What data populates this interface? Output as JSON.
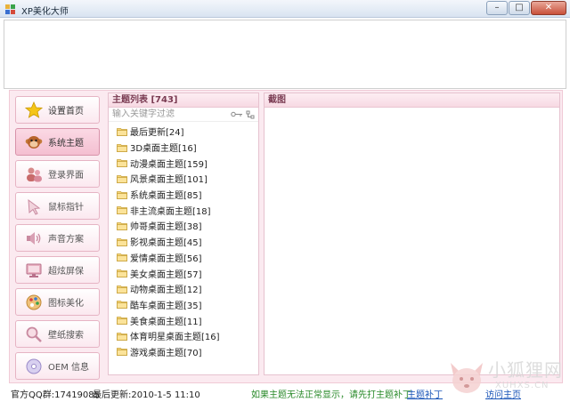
{
  "window": {
    "title": "XP美化大师",
    "minimize_glyph": "–",
    "maximize_glyph": "□",
    "close_glyph": "✕"
  },
  "sidebar": {
    "items": [
      {
        "label": "设置首页",
        "icon": "star-icon"
      },
      {
        "label": "系统主题",
        "icon": "monkey-icon",
        "active": true
      },
      {
        "label": "登录界面",
        "icon": "users-icon"
      },
      {
        "label": "鼠标指针",
        "icon": "cursor-icon"
      },
      {
        "label": "声音方案",
        "icon": "speaker-icon"
      },
      {
        "label": "超炫屏保",
        "icon": "monitor-icon"
      },
      {
        "label": "图标美化",
        "icon": "palette-icon"
      },
      {
        "label": "壁纸搜索",
        "icon": "magnifier-icon"
      },
      {
        "label": "OEM 信息",
        "icon": "cd-icon"
      }
    ]
  },
  "theme_list": {
    "header": "主题列表 [743]",
    "filter_placeholder": "输入关键字过滤",
    "items": [
      "最后更新[24]",
      "3D桌面主题[16]",
      "动漫桌面主题[159]",
      "风景桌面主题[101]",
      "系统桌面主题[85]",
      "非主流桌面主题[18]",
      "帅哥桌面主题[38]",
      "影视桌面主题[45]",
      "爱情桌面主题[56]",
      "美女桌面主题[57]",
      "动物桌面主题[12]",
      "酷车桌面主题[35]",
      "美食桌面主题[11]",
      "体育明星桌面主题[16]",
      "游戏桌面主题[70]"
    ]
  },
  "preview": {
    "header": "截图"
  },
  "status": {
    "qq": "官方QQ群:17419085",
    "updated": "最后更新:2010-1-5 11:10",
    "note": "如果主题无法正常显示，请先打主题补丁",
    "patch_link": "主题补丁",
    "home_link": "访问主页"
  },
  "watermark": {
    "text": "小狐狸网",
    "sub": "XUHXS.CN"
  },
  "colors": {
    "panel_bg": "#fbeaf0",
    "header_text": "#7a3b52",
    "note_green": "#2a8a2a",
    "link_blue": "#1a55b8"
  }
}
